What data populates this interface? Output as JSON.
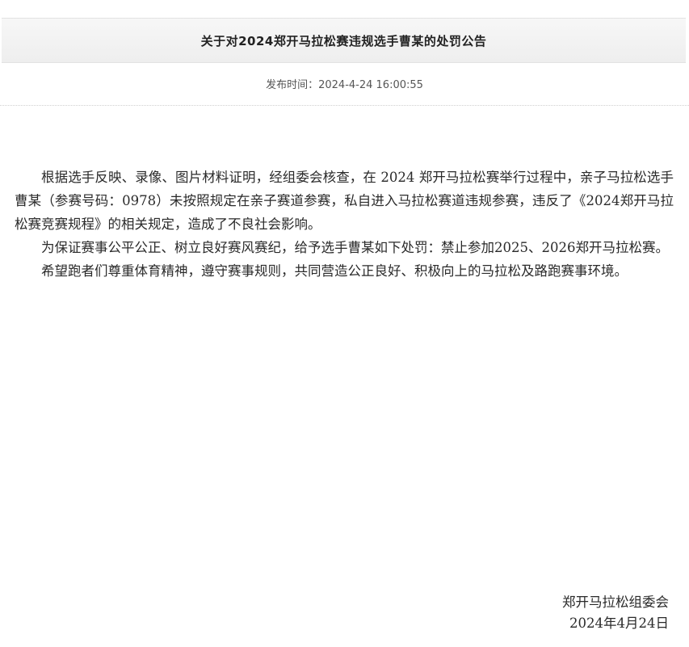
{
  "article": {
    "title": "关于对2024郑开马拉松赛违规选手曹某的处罚公告",
    "publish_label": "发布时间：",
    "publish_time": "2024-4-24 16:00:55",
    "paragraphs": [
      "根据选手反映、录像、图片材料证明，经组委会核查，在  2024 郑开马拉松赛举行过程中，亲子马拉松选手曹某（参赛号码：0978）未按照规定在亲子赛道参赛，私自进入马拉松赛道违规参赛，违反了《2024郑开马拉松赛竞赛规程》的相关规定，造成了不良社会影响。",
      "为保证赛事公平公正、树立良好赛风赛纪，给予选手曹某如下处罚：禁止参加2025、2026郑开马拉松赛。",
      "希望跑者们尊重体育精神，遵守赛事规则，共同营造公正良好、积极向上的马拉松及路跑赛事环境。"
    ],
    "signature": {
      "org": "郑开马拉松组委会",
      "date": "2024年4月24日"
    }
  }
}
